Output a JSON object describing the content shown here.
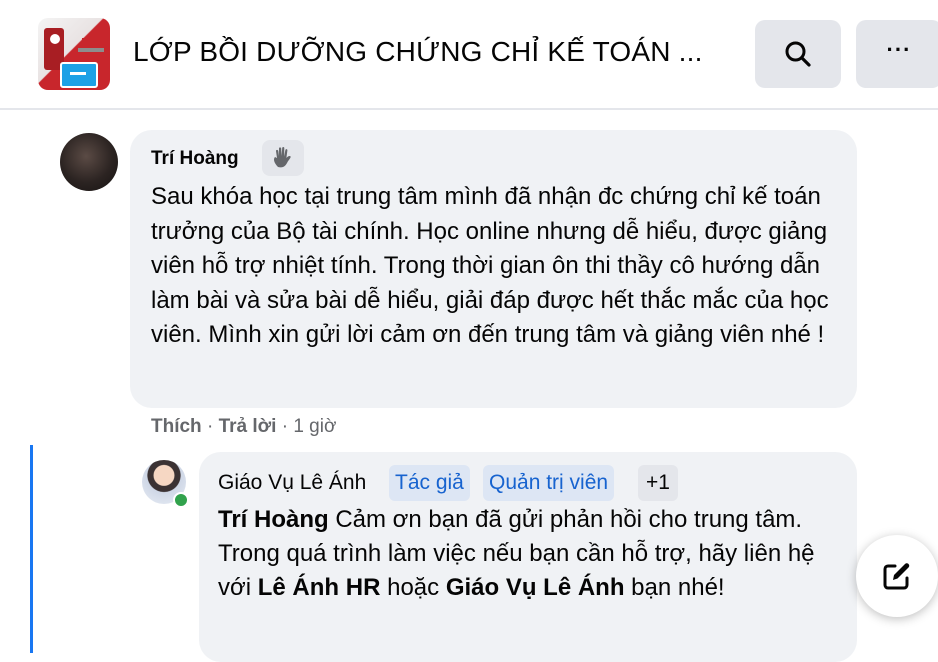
{
  "header": {
    "group_title": "LỚP BỒI DƯỠNG CHỨNG CHỈ KẾ TOÁN ...",
    "search_icon": "search-icon",
    "more_icon": "more-horizontal-icon",
    "more_label": "···"
  },
  "comment": {
    "author": "Trí Hoàng",
    "badge_icon": "wave-hand-icon",
    "text": "Sau khóa học tại trung tâm mình đã nhận đc chứng chỉ kế toán trưởng của Bộ tài chính. Học online nhưng dễ hiểu, được giảng viên hỗ trợ nhiệt tính. Trong thời gian ôn thi thầy cô hướng dẫn làm bài và sửa bài dễ hiểu, giải đáp được hết thắc mắc của học viên. Mình xin gửi lời cảm ơn đến trung tâm và giảng viên nhé !",
    "like_label": "Thích",
    "reply_label": "Trả lời",
    "time": "1 giờ",
    "separator": "·"
  },
  "reply": {
    "author": "Giáo Vụ Lê Ánh",
    "badges": {
      "author_badge": "Tác giả",
      "admin_badge": "Quản trị viên",
      "more_badge": "+1"
    },
    "mention": "Trí Hoàng",
    "text_part1": " Cảm ơn bạn đã gửi phản hồi cho trung tâm. Trong quá trình làm việc nếu bạn cần hỗ trợ, hãy liên hệ với ",
    "mention2": "Lê Ánh HR",
    "text_part2": " hoặc ",
    "mention3": "Giáo Vụ Lê Ánh",
    "text_part3": " bạn nhé!"
  },
  "fab": {
    "icon": "compose-icon"
  },
  "colors": {
    "bubble_bg": "#f0f2f5",
    "accent_blue": "#1877f2",
    "badge_text": "#1763cf",
    "online_green": "#31a24c",
    "muted_text": "#65676b"
  }
}
